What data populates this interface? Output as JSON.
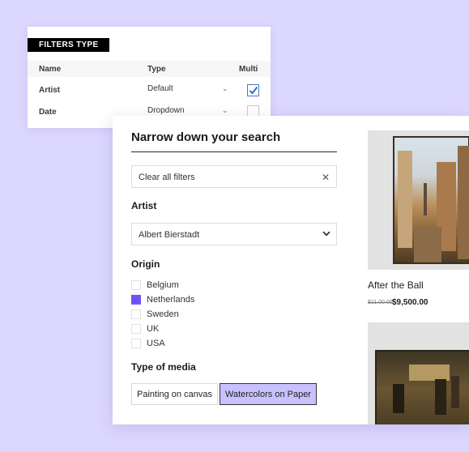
{
  "filters_type": {
    "badge": "FILTERS TYPE",
    "columns": {
      "name": "Name",
      "type": "Type",
      "multi": "Multi"
    },
    "rows": [
      {
        "name": "Artist",
        "type": "Default",
        "multi": true
      },
      {
        "name": "Date",
        "type": "Dropdown",
        "multi": false
      }
    ]
  },
  "panel": {
    "title": "Narrow down your search",
    "clear_label": "Clear all filters",
    "artist": {
      "title": "Artist",
      "selected": "Albert Bierstadt"
    },
    "origin": {
      "title": "Origin",
      "options": [
        {
          "label": "Belgium",
          "checked": false
        },
        {
          "label": "Netherlands",
          "checked": true
        },
        {
          "label": "Sweden",
          "checked": false
        },
        {
          "label": "UK",
          "checked": false
        },
        {
          "label": "USA",
          "checked": false
        }
      ]
    },
    "media": {
      "title": "Type of media",
      "options": [
        {
          "label": "Painting on canvas",
          "selected": false
        },
        {
          "label": "Watercolors on Paper",
          "selected": true
        }
      ]
    }
  },
  "products": [
    {
      "name": "After the Ball",
      "old_price": "$11,00.00",
      "price": "$9,500.00"
    }
  ],
  "colors": {
    "background": "#dcd7ff",
    "accent": "#6f52ff",
    "chip_selected": "#c9c1ff",
    "check_blue": "#4a78c6"
  }
}
